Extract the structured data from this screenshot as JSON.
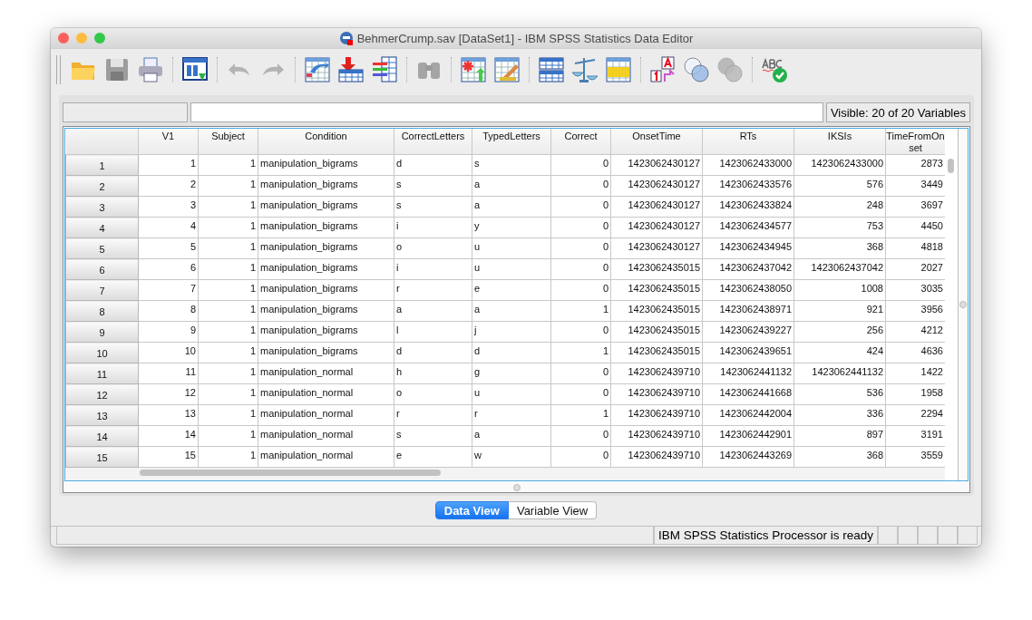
{
  "window": {
    "title": "BehmerCrump.sav [DataSet1] - IBM SPSS Statistics Data Editor"
  },
  "toolbar": [
    [
      {
        "kind": "open",
        "disabled": false
      },
      {
        "kind": "save",
        "disabled": true
      },
      {
        "kind": "print",
        "disabled": false
      }
    ],
    [
      {
        "kind": "recall",
        "disabled": false
      }
    ],
    [
      {
        "kind": "undo",
        "disabled": true
      },
      {
        "kind": "redo",
        "disabled": true
      }
    ],
    [
      {
        "kind": "goto-case",
        "disabled": false
      },
      {
        "kind": "goto-variable",
        "disabled": false
      },
      {
        "kind": "variables",
        "disabled": false
      }
    ],
    [
      {
        "kind": "find",
        "disabled": true
      }
    ],
    [
      {
        "kind": "insert-cases",
        "disabled": false
      },
      {
        "kind": "insert-variable",
        "disabled": false
      }
    ],
    [
      {
        "kind": "split-file",
        "disabled": false
      },
      {
        "kind": "weight-cases",
        "disabled": false
      },
      {
        "kind": "select-cases",
        "disabled": false
      }
    ],
    [
      {
        "kind": "value-labels",
        "disabled": false
      },
      {
        "kind": "use-sets",
        "disabled": false
      },
      {
        "kind": "show-all-sets",
        "disabled": true
      }
    ],
    [
      {
        "kind": "spelling",
        "disabled": false
      }
    ]
  ],
  "visible_label": "Visible: 20 of 20 Variables",
  "table": {
    "columns": [
      {
        "name": "V1"
      },
      {
        "name": "Subject"
      },
      {
        "name": "Condition"
      },
      {
        "name": "CorrectLetters"
      },
      {
        "name": "TypedLetters"
      },
      {
        "name": "Correct"
      },
      {
        "name": "OnsetTime"
      },
      {
        "name": "RTs"
      },
      {
        "name": "IKSIs"
      },
      {
        "name": "TimeFromOnset"
      }
    ],
    "rows": [
      {
        "number": "1",
        "cells": [
          "1",
          "1",
          "manipulation_bigrams",
          "d",
          "s",
          "0",
          "1423062430127",
          "1423062433000",
          "1423062433000",
          "2873"
        ]
      },
      {
        "number": "2",
        "cells": [
          "2",
          "1",
          "manipulation_bigrams",
          "s",
          "a",
          "0",
          "1423062430127",
          "1423062433576",
          "576",
          "3449"
        ]
      },
      {
        "number": "3",
        "cells": [
          "3",
          "1",
          "manipulation_bigrams",
          "s",
          "a",
          "0",
          "1423062430127",
          "1423062433824",
          "248",
          "3697"
        ]
      },
      {
        "number": "4",
        "cells": [
          "4",
          "1",
          "manipulation_bigrams",
          "i",
          "y",
          "0",
          "1423062430127",
          "1423062434577",
          "753",
          "4450"
        ]
      },
      {
        "number": "5",
        "cells": [
          "5",
          "1",
          "manipulation_bigrams",
          "o",
          "u",
          "0",
          "1423062430127",
          "1423062434945",
          "368",
          "4818"
        ]
      },
      {
        "number": "6",
        "cells": [
          "6",
          "1",
          "manipulation_bigrams",
          "i",
          "u",
          "0",
          "1423062435015",
          "1423062437042",
          "1423062437042",
          "2027"
        ]
      },
      {
        "number": "7",
        "cells": [
          "7",
          "1",
          "manipulation_bigrams",
          "r",
          "e",
          "0",
          "1423062435015",
          "1423062438050",
          "1008",
          "3035"
        ]
      },
      {
        "number": "8",
        "cells": [
          "8",
          "1",
          "manipulation_bigrams",
          "a",
          "a",
          "1",
          "1423062435015",
          "1423062438971",
          "921",
          "3956"
        ]
      },
      {
        "number": "9",
        "cells": [
          "9",
          "1",
          "manipulation_bigrams",
          "l",
          "j",
          "0",
          "1423062435015",
          "1423062439227",
          "256",
          "4212"
        ]
      },
      {
        "number": "10",
        "cells": [
          "10",
          "1",
          "manipulation_bigrams",
          "d",
          "d",
          "1",
          "1423062435015",
          "1423062439651",
          "424",
          "4636"
        ]
      },
      {
        "number": "11",
        "cells": [
          "11",
          "1",
          "manipulation_normal",
          "h",
          "g",
          "0",
          "1423062439710",
          "1423062441132",
          "1423062441132",
          "1422"
        ]
      },
      {
        "number": "12",
        "cells": [
          "12",
          "1",
          "manipulation_normal",
          "o",
          "u",
          "0",
          "1423062439710",
          "1423062441668",
          "536",
          "1958"
        ]
      },
      {
        "number": "13",
        "cells": [
          "13",
          "1",
          "manipulation_normal",
          "r",
          "r",
          "1",
          "1423062439710",
          "1423062442004",
          "336",
          "2294"
        ]
      },
      {
        "number": "14",
        "cells": [
          "14",
          "1",
          "manipulation_normal",
          "s",
          "a",
          "0",
          "1423062439710",
          "1423062442901",
          "897",
          "3191"
        ]
      },
      {
        "number": "15",
        "cells": [
          "15",
          "1",
          "manipulation_normal",
          "e",
          "w",
          "0",
          "1423062439710",
          "1423062443269",
          "368",
          "3559"
        ]
      }
    ]
  },
  "tabs": [
    {
      "label": "Data View",
      "selected": true
    },
    {
      "label": "Variable View",
      "selected": false
    }
  ],
  "status_bar": {
    "message": "IBM SPSS Statistics Processor is ready"
  }
}
